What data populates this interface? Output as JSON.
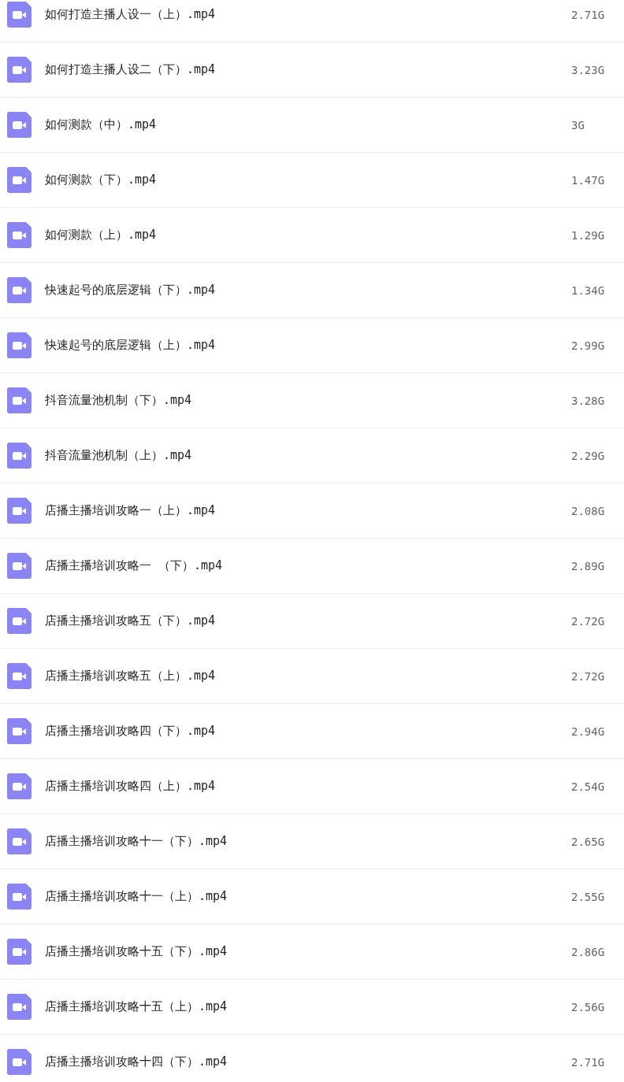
{
  "files": [
    {
      "name": "如何打造主播人设一（上）.mp4",
      "size": "2.71G"
    },
    {
      "name": "如何打造主播人设二（下）.mp4",
      "size": "3.23G"
    },
    {
      "name": "如何测款（中）.mp4",
      "size": "3G"
    },
    {
      "name": "如何测款（下）.mp4",
      "size": "1.47G"
    },
    {
      "name": "如何测款（上）.mp4",
      "size": "1.29G"
    },
    {
      "name": "快速起号的底层逻辑（下）.mp4",
      "size": "1.34G"
    },
    {
      "name": "快速起号的底层逻辑（上）.mp4",
      "size": "2.99G"
    },
    {
      "name": "抖音流量池机制（下）.mp4",
      "size": "3.28G"
    },
    {
      "name": "抖音流量池机制（上）.mp4",
      "size": "2.29G"
    },
    {
      "name": "店播主播培训攻略一（上）.mp4",
      "size": "2.08G"
    },
    {
      "name": "店播主播培训攻略一 （下）.mp4",
      "size": "2.89G"
    },
    {
      "name": "店播主播培训攻略五（下）.mp4",
      "size": "2.72G"
    },
    {
      "name": "店播主播培训攻略五（上）.mp4",
      "size": "2.72G"
    },
    {
      "name": "店播主播培训攻略四（下）.mp4",
      "size": "2.94G"
    },
    {
      "name": "店播主播培训攻略四（上）.mp4",
      "size": "2.54G"
    },
    {
      "name": "店播主播培训攻略十一（下）.mp4",
      "size": "2.65G"
    },
    {
      "name": "店播主播培训攻略十一（上）.mp4",
      "size": "2.55G"
    },
    {
      "name": "店播主播培训攻略十五（下）.mp4",
      "size": "2.86G"
    },
    {
      "name": "店播主播培训攻略十五（上）.mp4",
      "size": "2.56G"
    },
    {
      "name": "店播主播培训攻略十四（下）.mp4",
      "size": "2.71G"
    }
  ]
}
